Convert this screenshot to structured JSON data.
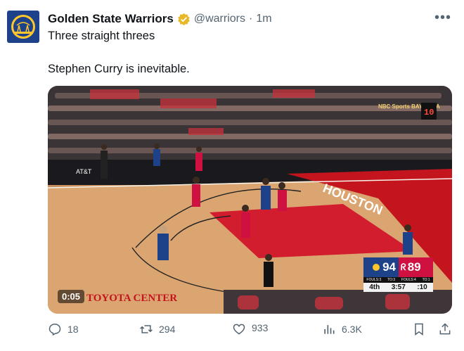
{
  "tweet": {
    "display_name": "Golden State Warriors",
    "handle": "@warriors",
    "separator": "·",
    "time": "1m",
    "more_label": "•••",
    "text_line1": "Three straight threes",
    "text_line2": "Stephen Curry is inevitable."
  },
  "video": {
    "duration": "0:05",
    "network": "NBC Sports BAY AREA",
    "shot_clock": "10",
    "arena_sign": "TOYOTA CENTER",
    "court_text": "HOUSTON",
    "sponsor": "AT&T"
  },
  "scorebug": {
    "away_score": "94",
    "home_score": "89",
    "fouls_away": "FOULS:3",
    "to_away": "TO:3",
    "fouls_home": "FOULS:4",
    "to_home": "TO:1",
    "quarter": "4th",
    "clock": "3:57",
    "shot_clock": ":10"
  },
  "actions": {
    "replies": "18",
    "retweets": "294",
    "likes": "933",
    "views": "6.3K"
  },
  "colors": {
    "warriors_blue": "#1d428a",
    "warriors_gold": "#ffc72c",
    "rockets_red": "#ce1141",
    "verified_gold": "#e8b829",
    "muted_text": "#536471"
  },
  "icons": [
    "warriors-logo-icon",
    "verified-badge-icon",
    "more-icon",
    "reply-icon",
    "retweet-icon",
    "like-icon",
    "views-icon",
    "bookmark-icon",
    "share-icon"
  ]
}
